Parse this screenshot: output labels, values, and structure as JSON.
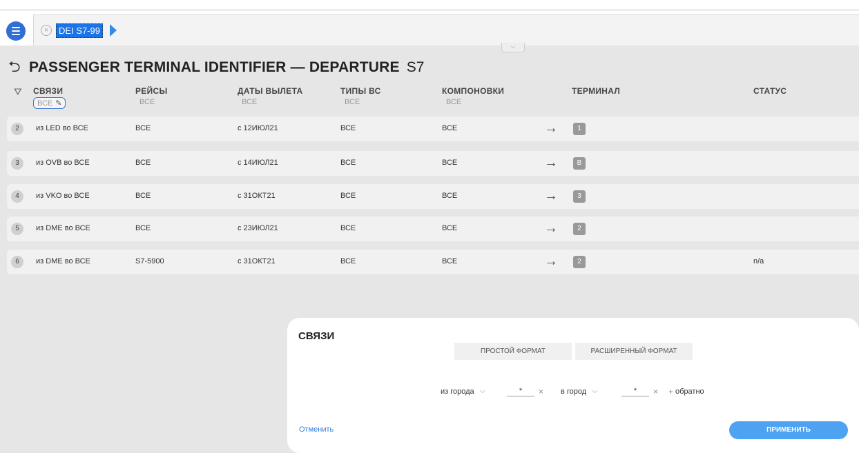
{
  "tab": {
    "label": "DEI S7-99"
  },
  "page": {
    "title": "PASSENGER TERMINAL IDENTIFIER — DEPARTURE",
    "subtitle": "S7"
  },
  "columns": [
    {
      "name": "СВЯЗИ",
      "value": "ВСЕ"
    },
    {
      "name": "РЕЙСЫ",
      "value": "ВСЕ"
    },
    {
      "name": "ДАТЫ ВЫЛЕТА",
      "value": "ВСЕ"
    },
    {
      "name": "ТИПЫ ВС",
      "value": "ВСЕ"
    },
    {
      "name": "КОМПОНОВКИ",
      "value": "ВСЕ"
    },
    {
      "name": "ТЕРМИНАЛ",
      "value": ""
    },
    {
      "name": "СТАТУС",
      "value": ""
    }
  ],
  "rows": [
    {
      "num": "2",
      "link": "из LED во ВСЕ",
      "flights": "ВСЕ",
      "dates": "с 12ИЮЛ21",
      "types": "ВСЕ",
      "layouts": "ВСЕ",
      "terminal": "1",
      "status": ""
    },
    {
      "num": "3",
      "link": "из OVB во ВСЕ",
      "flights": "ВСЕ",
      "dates": "с 14ИЮЛ21",
      "types": "ВСЕ",
      "layouts": "ВСЕ",
      "terminal": "B",
      "status": ""
    },
    {
      "num": "4",
      "link": "из VKO во ВСЕ",
      "flights": "ВСЕ",
      "dates": "с 31ОКТ21",
      "types": "ВСЕ",
      "layouts": "ВСЕ",
      "terminal": "3",
      "status": ""
    },
    {
      "num": "5",
      "link": "из DME во ВСЕ",
      "flights": "ВСЕ",
      "dates": "с 23ИЮЛ21",
      "types": "ВСЕ",
      "layouts": "ВСЕ",
      "terminal": "2",
      "status": ""
    },
    {
      "num": "6",
      "link": "из DME во ВСЕ",
      "flights": "S7-5900",
      "dates": "с 31ОКТ21",
      "types": "ВСЕ",
      "layouts": "ВСЕ",
      "terminal": "2",
      "status": "n/a"
    }
  ],
  "dialog": {
    "title": "СВЯЗИ",
    "simple_format": "ПРОСТОЙ ФОРМАТ",
    "extended_format": "РАСШИРЕННЫЙ ФОРМАТ",
    "from_city_label": "из города",
    "from_value": "*",
    "to_city_label": "в город",
    "to_value": "*",
    "reverse_label": "обратно",
    "cancel_label": "Отменить",
    "apply_label": "ПРИМЕНИТЬ"
  },
  "icons": {
    "menu": "hamburger-icon",
    "close_tab": "close-circle-icon",
    "back": "back-arrow-icon",
    "filter": "filter-icon",
    "edit": "pencil-icon",
    "row_arrow": "right-arrow-icon"
  },
  "colors": {
    "accent": "#2f6fd6",
    "apply": "#4da3f2",
    "workspace": "#e6e6e6"
  }
}
